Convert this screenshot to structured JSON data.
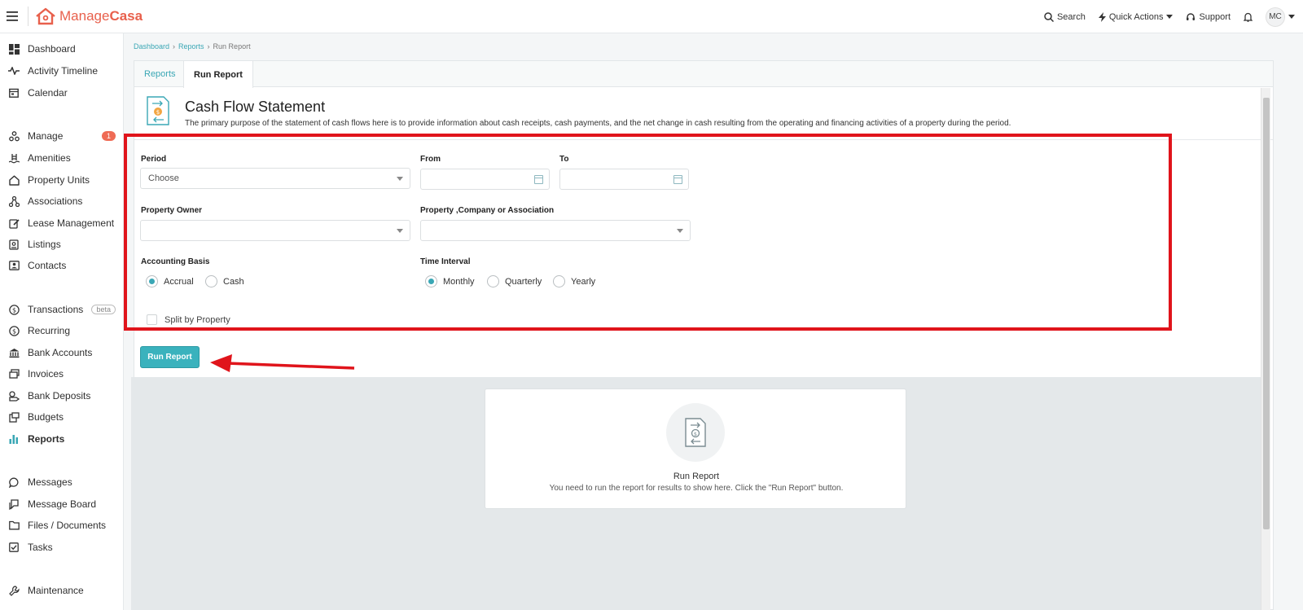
{
  "app": {
    "logo_prefix": "Manage",
    "logo_suffix": "Casa"
  },
  "topbar": {
    "search_label": "Search",
    "quick_actions_label": "Quick Actions",
    "support_label": "Support",
    "avatar_initials": "MC"
  },
  "sidebar": {
    "items": [
      {
        "label": "Dashboard",
        "icon": "dashboard-icon"
      },
      {
        "label": "Activity Timeline",
        "icon": "pulse-icon"
      },
      {
        "label": "Calendar",
        "icon": "calendar-icon"
      },
      {
        "label": "Manage",
        "icon": "manage-icon",
        "badge": "1"
      },
      {
        "label": "Amenities",
        "icon": "pool-icon"
      },
      {
        "label": "Property Units",
        "icon": "home-icon"
      },
      {
        "label": "Associations",
        "icon": "network-icon"
      },
      {
        "label": "Lease Management",
        "icon": "edit-icon"
      },
      {
        "label": "Listings",
        "icon": "listing-icon"
      },
      {
        "label": "Contacts",
        "icon": "contacts-icon"
      },
      {
        "label": "Transactions",
        "icon": "dollar-icon",
        "badge": "beta"
      },
      {
        "label": "Recurring",
        "icon": "dollar-icon"
      },
      {
        "label": "Bank Accounts",
        "icon": "bank-icon"
      },
      {
        "label": "Invoices",
        "icon": "invoice-icon"
      },
      {
        "label": "Bank Deposits",
        "icon": "deposit-icon"
      },
      {
        "label": "Budgets",
        "icon": "budget-icon"
      },
      {
        "label": "Reports",
        "icon": "bar-chart-icon"
      },
      {
        "label": "Messages",
        "icon": "message-icon"
      },
      {
        "label": "Message Board",
        "icon": "message-board-icon"
      },
      {
        "label": "Files / Documents",
        "icon": "folder-icon"
      },
      {
        "label": "Tasks",
        "icon": "checkbox-icon"
      },
      {
        "label": "Maintenance",
        "icon": "wrench-icon"
      }
    ]
  },
  "breadcrumb": {
    "items": [
      "Dashboard",
      "Reports",
      "Run Report"
    ]
  },
  "tabs": [
    {
      "label": "Reports",
      "active": false
    },
    {
      "label": "Run Report",
      "active": true
    }
  ],
  "report": {
    "title": "Cash Flow Statement",
    "description": "The primary purpose of the statement of cash flows here is to provide information about cash receipts, cash payments, and the net change in cash resulting from the operating and financing activities of a property during the period."
  },
  "form": {
    "period_label": "Period",
    "period_value": "Choose",
    "from_label": "From",
    "to_label": "To",
    "property_owner_label": "Property Owner",
    "property_company_label": "Property ,Company or Association",
    "accounting_basis_label": "Accounting Basis",
    "accounting_options": [
      {
        "label": "Accrual",
        "selected": true
      },
      {
        "label": "Cash",
        "selected": false
      }
    ],
    "time_interval_label": "Time Interval",
    "interval_options": [
      {
        "label": "Monthly",
        "selected": true
      },
      {
        "label": "Quarterly",
        "selected": false
      },
      {
        "label": "Yearly",
        "selected": false
      }
    ],
    "split_label": "Split by Property",
    "split_checked": false,
    "run_button_label": "Run Report"
  },
  "empty_state": {
    "title": "Run Report",
    "description": "You need to run the report for results to show here. Click the \"Run Report\" button."
  },
  "colors": {
    "brand": "#e8604c",
    "accent": "#3ab2bd",
    "annotation": "#e0141b"
  }
}
